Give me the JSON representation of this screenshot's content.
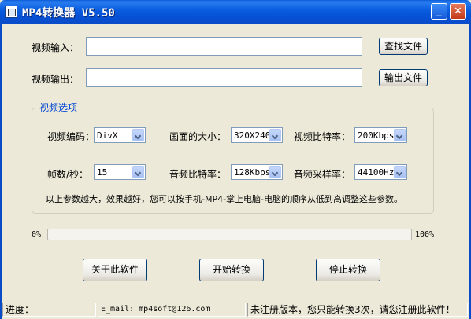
{
  "window": {
    "title": "MP4转换器 V5.50",
    "minimize": "_",
    "close": "✕"
  },
  "input": {
    "label": "视频输入：",
    "value": "",
    "browse_button": "查找文件"
  },
  "output": {
    "label": "视频输出：",
    "value": "",
    "browse_button": "输出文件"
  },
  "options": {
    "group_title": "视频选项",
    "video_codec": {
      "label": "视频编码：",
      "value": "DivX"
    },
    "frame_size": {
      "label": "画面的大小：",
      "value": "320X240"
    },
    "video_bitrate": {
      "label": "视频比特率：",
      "value": "200Kbps"
    },
    "fps": {
      "label": "帧数/秒：",
      "value": "15"
    },
    "audio_bitrate": {
      "label": "音频比特率：",
      "value": "128Kbps"
    },
    "sample_rate": {
      "label": "音频采样率：",
      "value": "44100Hz"
    },
    "hint": "以上参数越大，效果越好，您可以按手机-MP4-掌上电脑-电脑的顺序从低到高调整这些参数。"
  },
  "progress": {
    "start_label": "0%",
    "end_label": "100%",
    "value": 0
  },
  "buttons": {
    "about": "关于此软件",
    "start": "开始转换",
    "stop": "停止转换"
  },
  "statusbar": {
    "progress_label": "进度：",
    "email": "E_mail: mp4soft@126.com",
    "notice": "未注册版本，您只能转换3次，请您注册此软件！"
  },
  "icons": {
    "app": "app-window-icon",
    "dropdown": "chevron-down-icon"
  }
}
